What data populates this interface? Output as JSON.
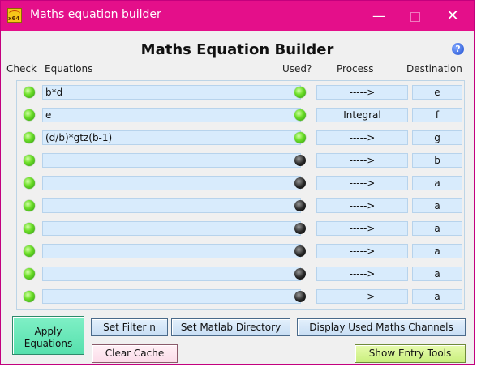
{
  "window": {
    "title": "Maths equation builder",
    "app_icon_label": "x64",
    "controls": {
      "minimize": "—",
      "maximize": "",
      "close": "✕"
    }
  },
  "heading": "Maths Equation Builder",
  "help_icon": "?",
  "columns": {
    "check": "Check",
    "equations": "Equations",
    "used": "Used?",
    "process": "Process",
    "destination": "Destination"
  },
  "rows": [
    {
      "check": "green",
      "equation": "b*d",
      "used": "green",
      "process": "----->",
      "destination": "e"
    },
    {
      "check": "green",
      "equation": "e",
      "used": "green",
      "process": "Integral",
      "destination": "f"
    },
    {
      "check": "green",
      "equation": "(d/b)*gtz(b-1)",
      "used": "green",
      "process": "----->",
      "destination": "g"
    },
    {
      "check": "green",
      "equation": "",
      "used": "dark",
      "process": "----->",
      "destination": "b"
    },
    {
      "check": "green",
      "equation": "",
      "used": "dark",
      "process": "----->",
      "destination": "a"
    },
    {
      "check": "green",
      "equation": "",
      "used": "dark",
      "process": "----->",
      "destination": "a"
    },
    {
      "check": "green",
      "equation": "",
      "used": "dark",
      "process": "----->",
      "destination": "a"
    },
    {
      "check": "green",
      "equation": "",
      "used": "dark",
      "process": "----->",
      "destination": "a"
    },
    {
      "check": "green",
      "equation": "",
      "used": "dark",
      "process": "----->",
      "destination": "a"
    },
    {
      "check": "green",
      "equation": "",
      "used": "dark",
      "process": "----->",
      "destination": "a"
    }
  ],
  "buttons": {
    "apply_line1": "Apply",
    "apply_line2": "Equations",
    "set_filter": "Set Filter n",
    "set_matlab": "Set Matlab Directory",
    "display_used": "Display Used Maths Channels",
    "clear_cache": "Clear Cache",
    "show_entry_tools": "Show Entry Tools"
  },
  "colors": {
    "titlebar": "#e40f8a",
    "field": "#d8ebfc",
    "led_on": "#6fe02a",
    "led_off": "#1a1a1a",
    "apply_button": "#66e6b5",
    "clear_button": "#fde4ee",
    "entry_tools_button": "#d2f28a"
  }
}
